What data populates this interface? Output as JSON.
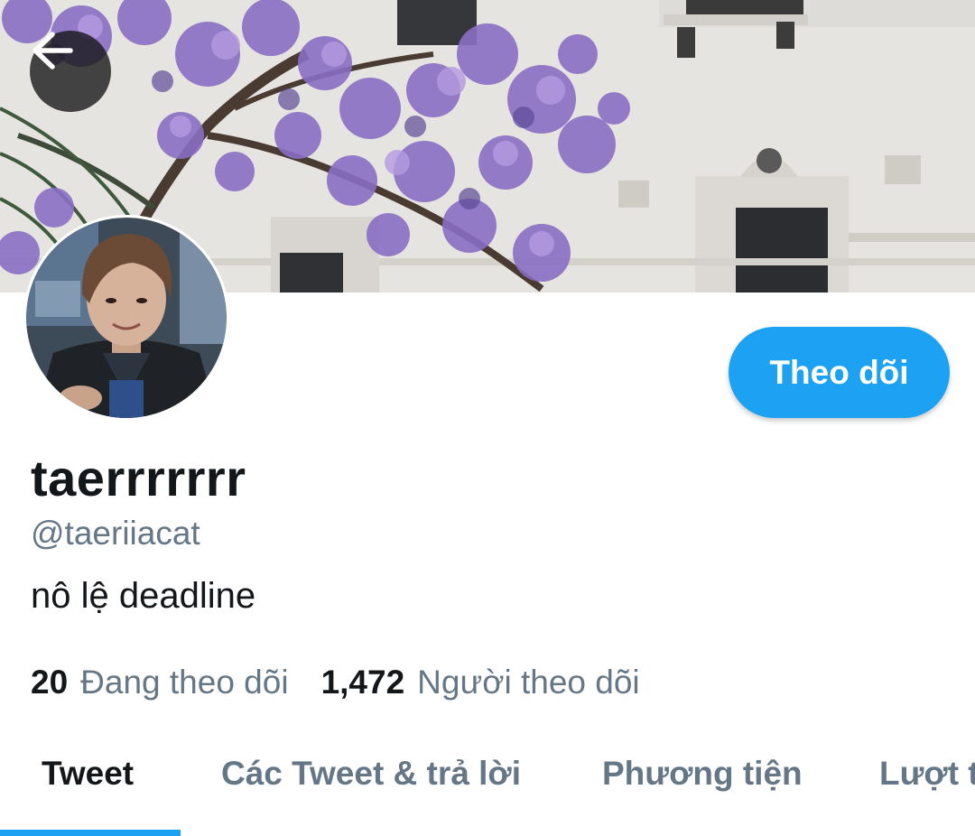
{
  "header": {
    "back_icon": "arrow-left-icon"
  },
  "profile": {
    "display_name": "taerrrrrrr",
    "handle": "@taeriiacat",
    "bio": "nô lệ deadline",
    "follow_label": "Theo dõi"
  },
  "stats": {
    "following_count": "20",
    "following_label": "Đang theo dõi",
    "followers_count": "1,472",
    "followers_label": "Người theo dõi"
  },
  "tabs": [
    {
      "label": "Tweet",
      "active": true
    },
    {
      "label": "Các Tweet & trả lời",
      "active": false
    },
    {
      "label": "Phương tiện",
      "active": false
    },
    {
      "label": "Lượt thích",
      "active": false
    }
  ],
  "colors": {
    "accent": "#1da1f2",
    "text_primary": "#14171a",
    "text_secondary": "#657786"
  }
}
